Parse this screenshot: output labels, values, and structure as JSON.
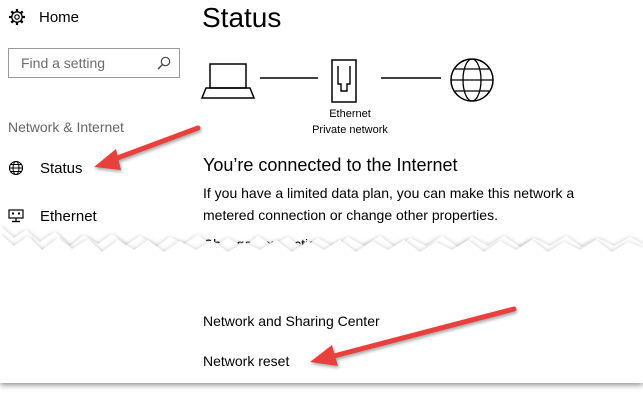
{
  "sidebar": {
    "home_label": "Home",
    "search_placeholder": "Find a setting",
    "section_title": "Network & Internet",
    "items": [
      {
        "label": "Status",
        "icon": "globe-icon"
      },
      {
        "label": "Ethernet",
        "icon": "ethernet-monitor-icon"
      }
    ]
  },
  "main": {
    "title": "Status",
    "network_name": "Ethernet",
    "network_type": "Private network",
    "connection_heading": "You’re connected to the Internet",
    "connection_description": "If you have a limited data plan, you can make this network a metered connection or change other properties.",
    "partial_link_text": "Change connection",
    "links": [
      {
        "label": "Network and Sharing Center"
      },
      {
        "label": "Network reset"
      }
    ]
  },
  "annotations": {
    "arrow_color": "#e8403d",
    "arrows": [
      {
        "points_to": "Status"
      },
      {
        "points_to": "Network reset"
      }
    ]
  },
  "icons": [
    "gear-icon",
    "search-icon",
    "globe-icon",
    "ethernet-monitor-icon",
    "laptop-icon",
    "ethernet-port-icon",
    "internet-globe-icon"
  ]
}
